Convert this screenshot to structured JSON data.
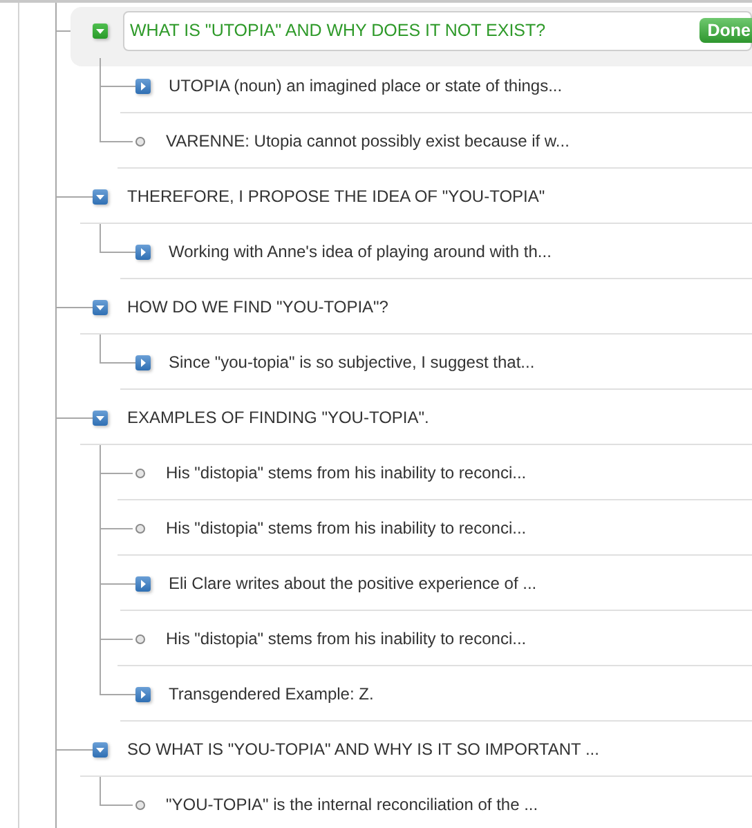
{
  "outline": [
    {
      "title": "WHAT IS \"UTOPIA\" AND WHY DOES IT NOT EXIST?",
      "expanded": true,
      "editing": true,
      "done_label": "Done",
      "children": [
        {
          "kind": "branch",
          "expanded": false,
          "text": "UTOPIA (noun) an imagined place or state of things..."
        },
        {
          "kind": "leaf",
          "text": "VARENNE: Utopia cannot possibly exist because if w..."
        }
      ]
    },
    {
      "title": "THEREFORE, I PROPOSE THE IDEA OF \"YOU-TOPIA\"",
      "expanded": true,
      "editing": false,
      "children": [
        {
          "kind": "branch",
          "expanded": false,
          "text": "Working with Anne's idea of playing around with th..."
        }
      ]
    },
    {
      "title": "HOW DO WE FIND \"YOU-TOPIA\"?",
      "expanded": true,
      "editing": false,
      "children": [
        {
          "kind": "branch",
          "expanded": false,
          "text": "Since \"you-topia\" is so subjective, I suggest that..."
        }
      ]
    },
    {
      "title": "EXAMPLES OF FINDING \"YOU-TOPIA\".",
      "expanded": true,
      "editing": false,
      "children": [
        {
          "kind": "leaf",
          "text": "His \"distopia\" stems from his inability to reconci..."
        },
        {
          "kind": "leaf",
          "text": "His \"distopia\" stems from his inability to reconci..."
        },
        {
          "kind": "branch",
          "expanded": false,
          "text": "Eli Clare writes about the positive experience of ..."
        },
        {
          "kind": "leaf",
          "text": "His \"distopia\" stems from his inability to reconci..."
        },
        {
          "kind": "branch",
          "expanded": false,
          "text": "Transgendered Example: Z."
        }
      ]
    },
    {
      "title": "SO WHAT IS \"YOU-TOPIA\" AND WHY IS IT SO IMPORTANT ...",
      "expanded": true,
      "editing": false,
      "children": [
        {
          "kind": "leaf",
          "text": "\"YOU-TOPIA\" is the internal reconciliation of the ..."
        }
      ]
    }
  ]
}
